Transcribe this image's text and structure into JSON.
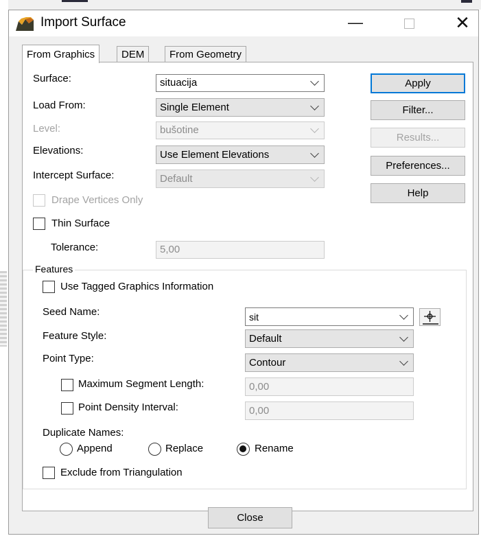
{
  "window": {
    "title": "Import Surface",
    "minimize": "—",
    "close": "✕"
  },
  "tabs": [
    "From Graphics",
    "DEM",
    "From Geometry"
  ],
  "form": {
    "surface": {
      "label": "Surface:",
      "value": "situacija"
    },
    "load_from": {
      "label": "Load From:",
      "value": "Single Element"
    },
    "level": {
      "label": "Level:",
      "value": "bušotine"
    },
    "elevations": {
      "label": "Elevations:",
      "value": "Use Element Elevations"
    },
    "intercept": {
      "label": "Intercept Surface:",
      "value": "Default"
    },
    "drape": "Drape Vertices Only",
    "thin": "Thin Surface",
    "tolerance": {
      "label": "Tolerance:",
      "value": "5,00"
    }
  },
  "side_buttons": {
    "apply": "Apply",
    "filter": "Filter...",
    "results": "Results...",
    "preferences": "Preferences...",
    "help": "Help"
  },
  "features": {
    "title": "Features",
    "use_tagged": "Use Tagged Graphics Information",
    "seed_name": {
      "label": "Seed Name:",
      "value": "sit"
    },
    "feature_style": {
      "label": "Feature Style:",
      "value": "Default"
    },
    "point_type": {
      "label": "Point Type:",
      "value": "Contour"
    },
    "max_seg": {
      "label": "Maximum Segment Length:",
      "value": "0,00"
    },
    "point_density": {
      "label": "Point Density Interval:",
      "value": "0,00"
    },
    "duplicate": {
      "label": "Duplicate Names:",
      "options": [
        "Append",
        "Replace",
        "Rename"
      ],
      "selected": "Rename"
    },
    "exclude": "Exclude from Triangulation"
  },
  "close_button": "Close",
  "icons": {
    "app": "import-surface-icon",
    "pick": "crosshair-pick-icon"
  }
}
